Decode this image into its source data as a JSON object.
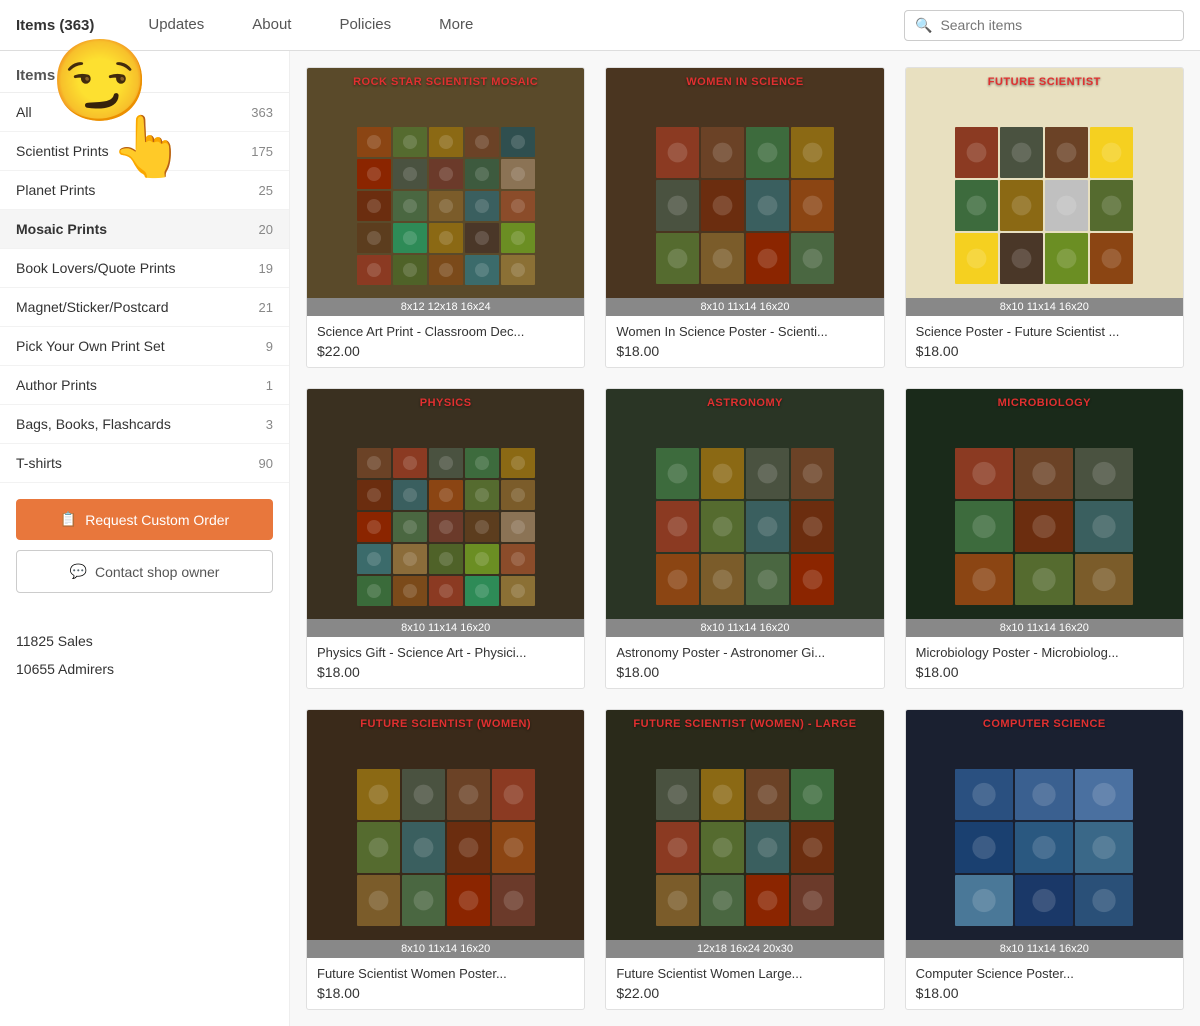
{
  "nav": {
    "items_count_label": "Items (363)",
    "links": [
      {
        "id": "updates",
        "label": "Updates"
      },
      {
        "id": "about",
        "label": "About"
      },
      {
        "id": "policies",
        "label": "Policies"
      },
      {
        "id": "more",
        "label": "More"
      }
    ],
    "search_placeholder": "Search items"
  },
  "sidebar": {
    "section_title": "Items",
    "categories": [
      {
        "id": "all",
        "label": "All",
        "count": "363",
        "active": false
      },
      {
        "id": "scientist-prints",
        "label": "Scientist Prints",
        "count": "175",
        "active": false
      },
      {
        "id": "planet-prints",
        "label": "Planet Prints",
        "count": "25",
        "active": false
      },
      {
        "id": "mosaic-prints",
        "label": "Mosaic Prints",
        "count": "20",
        "active": true
      },
      {
        "id": "book-lovers",
        "label": "Book Lovers/Quote Prints",
        "count": "19",
        "active": false
      },
      {
        "id": "magnet-sticker",
        "label": "Magnet/Sticker/Postcard",
        "count": "21",
        "active": false
      },
      {
        "id": "pick-your-own",
        "label": "Pick Your Own Print Set",
        "count": "9",
        "active": false
      },
      {
        "id": "author-prints",
        "label": "Author Prints",
        "count": "1",
        "active": false
      },
      {
        "id": "bags-books",
        "label": "Bags, Books, Flashcards",
        "count": "3",
        "active": false
      },
      {
        "id": "tshirts",
        "label": "T-shirts",
        "count": "90",
        "active": false
      }
    ],
    "btn_custom_order": "Request Custom Order",
    "btn_contact_owner": "Contact shop owner",
    "stats": [
      {
        "label": "11825 Sales"
      },
      {
        "label": "10655 Admirers"
      }
    ]
  },
  "products": [
    {
      "id": "rock-star",
      "title": "ROCK STAR SCIENTIST MOSAIC",
      "sizes": "8x12  12x18  16x24",
      "name": "Science Art Print - Classroom Dec...",
      "price": "$22.00",
      "bg_color": "#5a4a2a",
      "cells": [
        "#8B4513",
        "#556B2F",
        "#8B6914",
        "#6B4226",
        "#2F4F4F",
        "#8B2500",
        "#4A5240",
        "#6B3A2A",
        "#3D5A3E",
        "#8B7355",
        "#6B2D0F",
        "#4A6741",
        "#7B5C2A",
        "#3A5F5F",
        "#8B4C2A",
        "#5C3D1E",
        "#2E8B57",
        "#8B6914",
        "#4A3728",
        "#6B8E23",
        "#8B3A22",
        "#4F6228",
        "#7B4A1A",
        "#3B6B6B",
        "#8B7035"
      ],
      "grid": "5x5"
    },
    {
      "id": "women-in-science",
      "title": "WOMEN IN SCIENCE",
      "sizes": "8x10  11x14  16x20",
      "name": "Women In Science Poster - Scienti...",
      "price": "$18.00",
      "bg_color": "#4a3520",
      "cells": [
        "#8B3A22",
        "#6B4226",
        "#3D6B3D",
        "#8B6914",
        "#4A5240",
        "#6B2D0F",
        "#3A5F5F",
        "#8B4513",
        "#556B2F",
        "#7B5C2A",
        "#8B2500",
        "#4A6741",
        "#6B3A2A",
        "#5C3D1E",
        "#8B7355",
        "#3B6B6B",
        "#8B6C3A",
        "#4F6228",
        "#6B8E23",
        "#8B4C2A",
        "#3A6B3A",
        "#7B4A1A",
        "#8B3A22",
        "#2E8B57",
        "#8B7035",
        "#4A3728",
        "#6B8E23",
        "#8B6914",
        "#4A5240",
        "#6B2D0F",
        "#3A5F5F",
        "#8B4513"
      ],
      "grid": "4x3"
    },
    {
      "id": "future-scientist",
      "title": "FUTURE SCIENTIST",
      "sizes": "8x10  11x14  16x20",
      "name": "Science Poster - Future Scientist ...",
      "price": "$18.00",
      "bg_color": "#e8e0c0",
      "cells": [
        "#8B3A22",
        "#4A5240",
        "#6B4226",
        "#F5D020",
        "#3D6B3D",
        "#8B6914",
        "#c0c0c0",
        "#556B2F",
        "#F5D020",
        "#4A3728",
        "#6B8E23",
        "#8B4513",
        "#3A5F5F",
        "#F5D020",
        "#8B2500",
        "#4A6741",
        "#6B3A2A",
        "#8B7355",
        "#3B6B6B",
        "#8B6C3A"
      ],
      "grid": "4x3"
    },
    {
      "id": "physics",
      "title": "PHYSICS",
      "sizes": "8x10  11x14  16x20",
      "name": "Physics Gift - Science Art - Physici...",
      "price": "$18.00",
      "bg_color": "#3a3020",
      "cells": [
        "#6B4226",
        "#8B3A22",
        "#4A5240",
        "#3D6B3D",
        "#8B6914",
        "#6B2D0F",
        "#3A5F5F",
        "#8B4513",
        "#556B2F",
        "#7B5C2A",
        "#8B2500",
        "#4A6741",
        "#6B3A2A",
        "#5C3D1E",
        "#8B7355",
        "#3B6B6B",
        "#8B6C3A",
        "#4F6228",
        "#6B8E23",
        "#8B4C2A",
        "#3A6B3A",
        "#7B4A1A",
        "#8B3A22",
        "#2E8B57",
        "#8B7035"
      ],
      "grid": "5x5"
    },
    {
      "id": "astronomy",
      "title": "ASTRONOMY",
      "sizes": "8x10  11x14  16x20",
      "name": "Astronomy Poster - Astronomer Gi...",
      "price": "$18.00",
      "bg_color": "#2a3525",
      "cells": [
        "#3D6B3D",
        "#8B6914",
        "#4A5240",
        "#6B4226",
        "#8B3A22",
        "#556B2F",
        "#3A5F5F",
        "#6B2D0F",
        "#8B4513",
        "#7B5C2A",
        "#4A6741",
        "#8B2500",
        "#6B3A2A",
        "#5C3D1E",
        "#8B7355",
        "#3B6B6B",
        "#8B6C3A",
        "#4F6228",
        "#6B8E23",
        "#8B4C2A"
      ],
      "grid": "4x3"
    },
    {
      "id": "microbiology",
      "title": "MICROBIOLOGY",
      "sizes": "8x10  11x14  16x20",
      "name": "Microbiology Poster - Microbiolog...",
      "price": "$18.00",
      "bg_color": "#1a2a1a",
      "cells": [
        "#8B3A22",
        "#6B4226",
        "#4A5240",
        "#3D6B3D",
        "#6B2D0F",
        "#3A5F5F",
        "#8B4513",
        "#556B2F",
        "#7B5C2A",
        "#8B2500",
        "#4A6741",
        "#6B3A2A"
      ],
      "grid": "3x3"
    },
    {
      "id": "future-scientist-women",
      "title": "FUTURE SCIENTIST (WOMEN)",
      "sizes": "8x10  11x14  16x20",
      "name": "Future Scientist Women Poster...",
      "price": "$18.00",
      "bg_color": "#3a2a1a",
      "cells": [
        "#8B6914",
        "#4A5240",
        "#6B4226",
        "#8B3A22",
        "#556B2F",
        "#3A5F5F",
        "#6B2D0F",
        "#8B4513",
        "#7B5C2A",
        "#4A6741",
        "#8B2500",
        "#6B3A2A",
        "#5C3D1E",
        "#8B7355",
        "#3B6B6B",
        "#8B6C3A",
        "#4F6228",
        "#6B8E23",
        "#8B4C2A",
        "#3A6B3A"
      ],
      "grid": "4x3"
    },
    {
      "id": "future-scientist-women-large",
      "title": "FUTURE SCIENTIST (WOMEN) - LARGE",
      "sizes": "12x18  16x24  20x30",
      "name": "Future Scientist Women Large...",
      "price": "$22.00",
      "bg_color": "#2a2a1a",
      "cells": [
        "#4A5240",
        "#8B6914",
        "#6B4226",
        "#3D6B3D",
        "#8B3A22",
        "#556B2F",
        "#3A5F5F",
        "#6B2D0F",
        "#7B5C2A",
        "#4A6741",
        "#8B2500",
        "#6B3A2A",
        "#5C3D1E",
        "#8B7355",
        "#3B6B6B",
        "#8B6C3A",
        "#4F6228",
        "#6B8E23",
        "#8B4C2A",
        "#3A6B3A"
      ],
      "grid": "4x3"
    },
    {
      "id": "computer-science",
      "title": "COMPUTER SCIENCE",
      "sizes": "8x10  11x14  16x20",
      "name": "Computer Science Poster...",
      "price": "$18.00",
      "bg_color": "#1a2030",
      "cells": [
        "#2a5080",
        "#3a6090",
        "#4a70a0",
        "#1a4070",
        "#2a5880",
        "#3a6888",
        "#4a7898",
        "#1a3868",
        "#2a5078",
        "#3a6088",
        "#4a7098",
        "#1a3060"
      ],
      "grid": "3x3"
    }
  ]
}
